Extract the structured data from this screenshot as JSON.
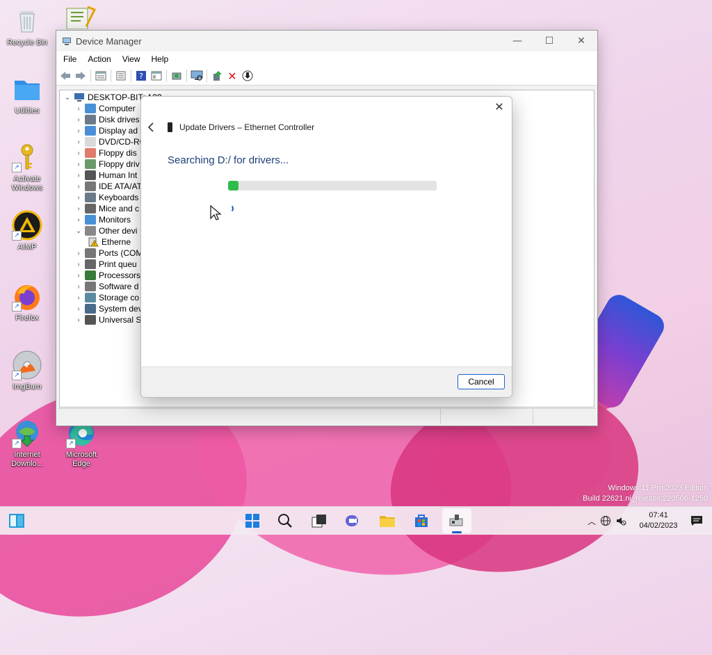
{
  "desktop": {
    "icons": [
      {
        "label": "Recycle Bin"
      },
      {
        "label": "Utilities"
      },
      {
        "label": "Activate Windows"
      },
      {
        "label": "AIMP"
      },
      {
        "label": "Firefox"
      },
      {
        "label": "ImgBurn"
      },
      {
        "label": "Internet Downlo..."
      },
      {
        "label": "Microsoft Edge"
      }
    ]
  },
  "device_manager": {
    "title": "Device Manager",
    "menu": [
      "File",
      "Action",
      "View",
      "Help"
    ],
    "toolbar_icons": [
      "back-icon",
      "forward-icon",
      "properties-view-icon",
      "properties-icon",
      "help-icon",
      "show-hidden-icon",
      "update-driver-icon",
      "scan-hardware-icon",
      "add-driver-icon",
      "uninstall-icon",
      "download-icon"
    ],
    "tree": {
      "root": "DESKTOP-BIToA??",
      "nodes": [
        {
          "label": "Computer",
          "expanded": false
        },
        {
          "label": "Disk drives",
          "expanded": false
        },
        {
          "label": "Display ad",
          "expanded": false
        },
        {
          "label": "DVD/CD-RC",
          "expanded": false
        },
        {
          "label": "Floppy dis",
          "expanded": false
        },
        {
          "label": "Floppy driv",
          "expanded": false
        },
        {
          "label": "Human Int",
          "expanded": false
        },
        {
          "label": "IDE ATA/AT",
          "expanded": false
        },
        {
          "label": "Keyboards",
          "expanded": false
        },
        {
          "label": "Mice and c",
          "expanded": false
        },
        {
          "label": "Monitors",
          "expanded": false
        },
        {
          "label": "Other devi",
          "expanded": true
        },
        {
          "label": "Etherne",
          "child": true
        },
        {
          "label": "Ports (COM",
          "expanded": false
        },
        {
          "label": "Print queu",
          "expanded": false
        },
        {
          "label": "Processors",
          "expanded": false
        },
        {
          "label": "Software d",
          "expanded": false
        },
        {
          "label": "Storage co",
          "expanded": false
        },
        {
          "label": "System dev",
          "expanded": false
        },
        {
          "label": "Universal S",
          "expanded": false
        }
      ]
    }
  },
  "dialog": {
    "header": "Update Drivers – Ethernet Controller",
    "message": "Searching D:/ for drivers...",
    "progress": 0.05,
    "cancel_label": "Cancel"
  },
  "watermark": {
    "line1": "Windows 11 Pro 2023 Edition",
    "line2": "Build 22621.ni_release.220506-1250"
  },
  "taskbar": {
    "time": "07:41",
    "date": "04/02/2023"
  },
  "colors": {
    "progress_fill": "#2ebd4a",
    "dialog_message": "#1e3f78",
    "accent": "#1a60c8"
  }
}
